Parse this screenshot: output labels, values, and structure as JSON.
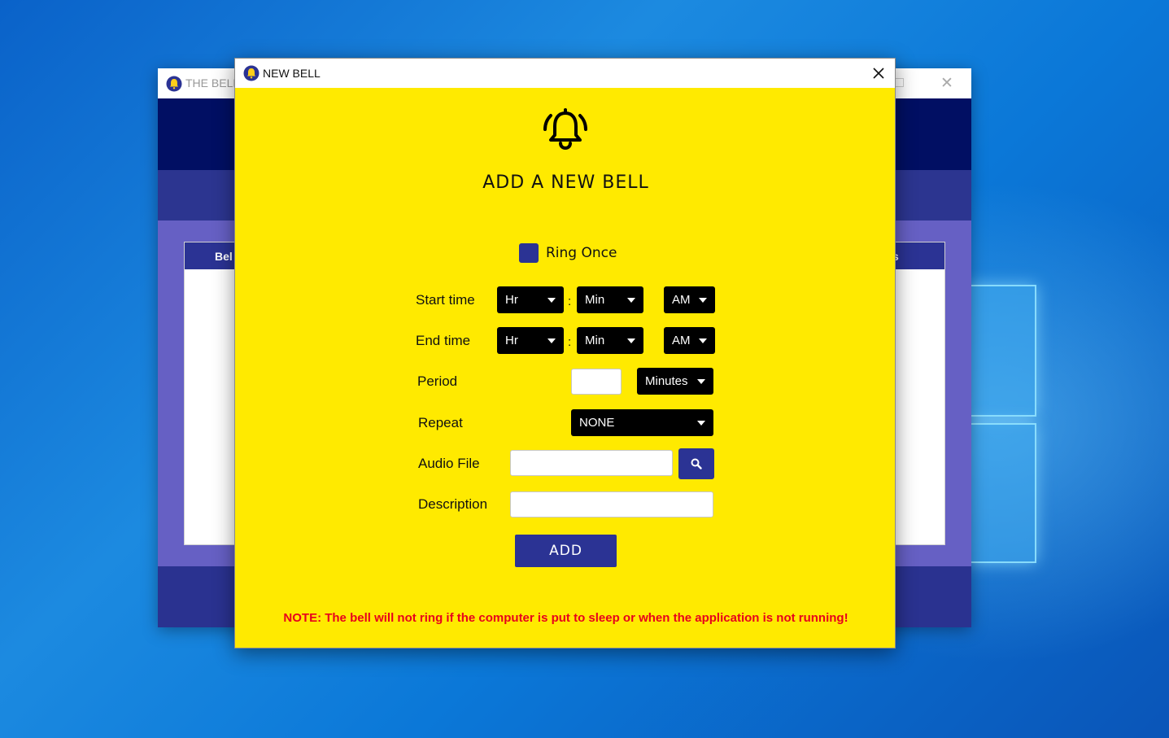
{
  "background_window": {
    "title": "THE BELL",
    "table": {
      "column_left": "Bel",
      "column_right": "s"
    }
  },
  "dialog": {
    "title": "NEW BELL",
    "heading": "ADD A NEW BELL",
    "ring_once": {
      "label": "Ring Once",
      "checked": true
    },
    "labels": {
      "start_time": "Start time",
      "end_time": "End time",
      "period": "Period",
      "repeat": "Repeat",
      "audio_file": "Audio File",
      "description": "Description"
    },
    "start_time": {
      "hour": "Hr",
      "separator": ":",
      "minute": "Min",
      "ampm": "AM"
    },
    "end_time": {
      "hour": "Hr",
      "separator": ":",
      "minute": "Min",
      "ampm": "AM"
    },
    "period": {
      "value": "",
      "unit": "Minutes"
    },
    "repeat": {
      "value": "NONE"
    },
    "audio_file": {
      "value": ""
    },
    "description": {
      "value": ""
    },
    "add_button": "ADD",
    "note": "NOTE: The bell will not ring if the computer is put to sleep or when the application is not running!"
  },
  "colors": {
    "dialog_background": "#ffea00",
    "accent_blue": "#2b3394",
    "header_navy": "#010f63",
    "body_purple": "#6660c4",
    "note_red": "#e8001c",
    "dropdown_black": "#000000"
  },
  "icons": [
    "bell-icon",
    "app-bell-icon",
    "close-icon",
    "search-icon",
    "dropdown-arrow-icon",
    "windows-logo-icon"
  ]
}
